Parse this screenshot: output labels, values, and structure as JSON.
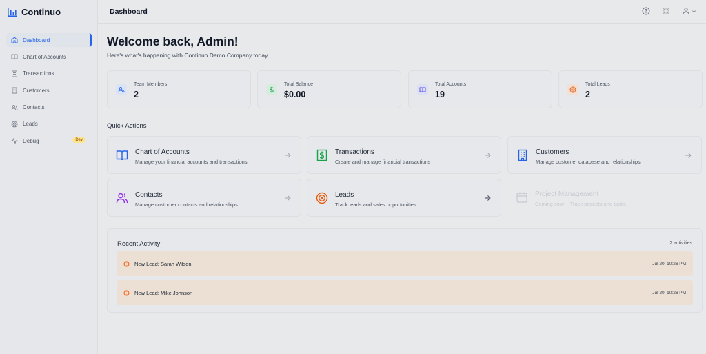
{
  "brand": {
    "name": "Continuo"
  },
  "sidebar": {
    "items": [
      {
        "label": "Dashboard",
        "icon": "home-icon",
        "active": true
      },
      {
        "label": "Chart of Accounts",
        "icon": "book-icon"
      },
      {
        "label": "Transactions",
        "icon": "receipt-icon"
      },
      {
        "label": "Customers",
        "icon": "building-icon"
      },
      {
        "label": "Contacts",
        "icon": "users-icon"
      },
      {
        "label": "Leads",
        "icon": "target-icon"
      },
      {
        "label": "Debug",
        "icon": "activity-icon",
        "badge": "Dev"
      }
    ]
  },
  "header": {
    "title": "Dashboard",
    "icons": [
      "help-icon",
      "settings-icon",
      "user-menu-icon"
    ]
  },
  "welcome": {
    "title": "Welcome back, Admin!",
    "subtitle": "Here's what's happening with Continuo Demo Company today."
  },
  "stats": [
    {
      "label": "Team Members",
      "value": "2",
      "icon": "users-icon",
      "color": "#2563eb"
    },
    {
      "label": "Total Balance",
      "value": "$0.00",
      "icon": "dollar-icon",
      "color": "#16a34a"
    },
    {
      "label": "Total Accounts",
      "value": "19",
      "icon": "book-icon",
      "color": "#4f46e5"
    },
    {
      "label": "Total Leads",
      "value": "2",
      "icon": "target-icon",
      "color": "#ea580c"
    }
  ],
  "quick_actions": {
    "title": "Quick Actions",
    "items": [
      {
        "title": "Chart of Accounts",
        "desc": "Manage your financial accounts and transactions",
        "icon": "book-icon",
        "color": "#2563eb"
      },
      {
        "title": "Transactions",
        "desc": "Create and manage financial transactions",
        "icon": "dollar-icon",
        "color": "#16a34a"
      },
      {
        "title": "Customers",
        "desc": "Manage customer database and relationships",
        "icon": "building-icon",
        "color": "#2563eb"
      },
      {
        "title": "Contacts",
        "desc": "Manage customer contacts and relationships",
        "icon": "users-icon",
        "color": "#9333ea"
      },
      {
        "title": "Leads",
        "desc": "Track leads and sales opportunities",
        "icon": "target-icon",
        "color": "#ea580c"
      },
      {
        "title": "Project Management",
        "desc": "Coming soon - Track projects and tasks",
        "icon": "calendar-icon",
        "color": "#9ca3af",
        "disabled": true
      }
    ]
  },
  "activity": {
    "title": "Recent Activity",
    "count": "2 activities",
    "items": [
      {
        "text": "New Lead: Sarah Wilson",
        "time": "Jul 20, 10:26 PM"
      },
      {
        "text": "New Lead: Mike Johnson",
        "time": "Jul 20, 10:26 PM"
      }
    ]
  }
}
